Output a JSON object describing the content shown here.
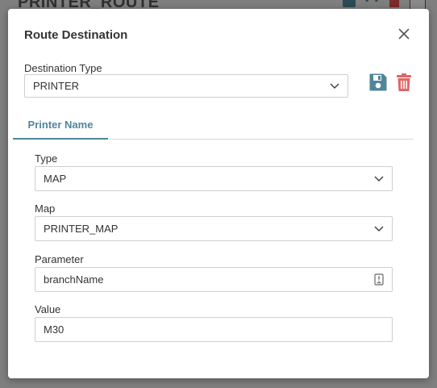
{
  "background": {
    "title": "PRINTER_ROUTE"
  },
  "dialog": {
    "title": "Route Destination",
    "destination_type": {
      "label": "Destination Type",
      "value": "PRINTER"
    },
    "tabs": [
      {
        "label": "Printer Name",
        "active": true
      }
    ],
    "fields": {
      "type": {
        "label": "Type",
        "value": "MAP"
      },
      "map": {
        "label": "Map",
        "value": "PRINTER_MAP"
      },
      "parameter": {
        "label": "Parameter",
        "value": "branchName"
      },
      "value": {
        "label": "Value",
        "value": "M30"
      }
    }
  },
  "icons": {
    "save": "save-icon",
    "delete": "trash-icon",
    "close": "close-icon",
    "dropdown": "chevron-down-icon",
    "parameter": "parameter-picker-icon"
  },
  "colors": {
    "accent": "#4f8699",
    "save_icon": "#4f8699",
    "delete_icon": "#e06666",
    "overlay": "#7f7f7f"
  }
}
